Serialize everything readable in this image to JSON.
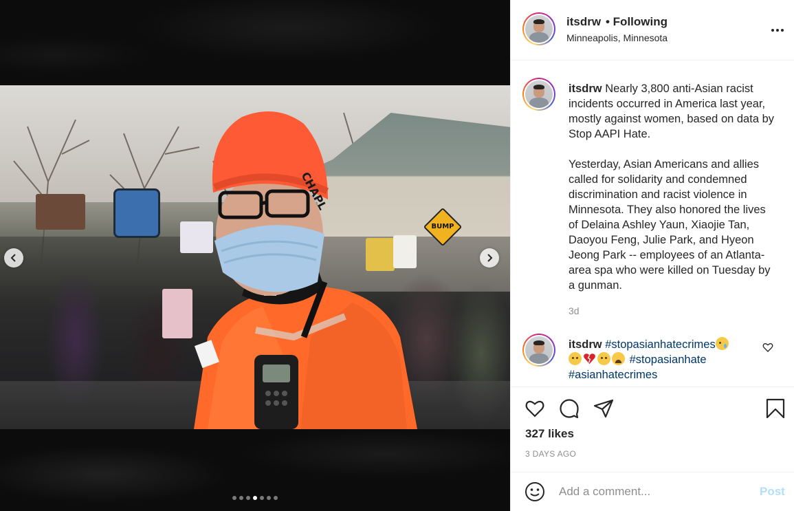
{
  "post": {
    "username": "itsdrw",
    "follow_status": "• Following",
    "location": "Minneapolis, Minnesota",
    "caption": {
      "username": "itsdrw",
      "paragraph1": "Nearly 3,800 anti-Asian racist incidents occurred in America last year, mostly against women, based on data by Stop AAPI Hate.",
      "paragraph2": "Yesterday, Asian Americans and allies called for solidarity and condemned discrimination and racist violence in Minnesota. They also honored the lives of Delaina Ashley Yaun, Xiaojie Tan, Daoyou Feng, Julie Park, and Hyeon Jeong Park -- employees of an Atlanta-area spa who were killed on Tuesday by a gunman.",
      "age": "3d"
    },
    "comment": {
      "username": "itsdrw",
      "tag1": "#stopasianhatecrimes",
      "tag2": "#stopasianhate",
      "tag3": "#asianhatecrimes",
      "emoji_names": [
        "crying-face",
        "disappointed-face",
        "broken-heart",
        "disappointed-face",
        "weary-face"
      ]
    },
    "likes": "327 likes",
    "date": "3 DAYS AGO",
    "photo_sign_text": "CHAPL",
    "photo_sign_text2": "BUMP",
    "carousel": {
      "slide_count": 7,
      "active_index": 3
    }
  },
  "add_comment": {
    "placeholder": "Add a comment...",
    "post_label": "Post"
  },
  "icons": {
    "like": "heart-icon",
    "comment": "comment-icon",
    "share": "paper-plane-icon",
    "save": "bookmark-icon",
    "emoji": "smiley-icon",
    "more": "ellipsis-icon",
    "prev": "chevron-left-icon",
    "next": "chevron-right-icon"
  },
  "colors": {
    "link": "#00376b",
    "muted": "#8e8e8e",
    "post_disabled": "#b2dffc",
    "vest": "#ff6a2a",
    "beanie": "#ff5a36"
  }
}
